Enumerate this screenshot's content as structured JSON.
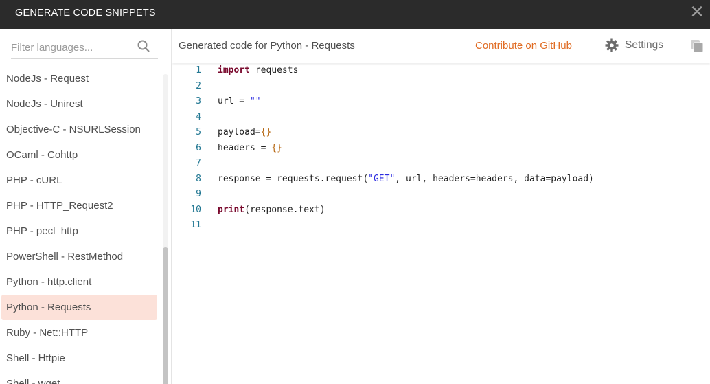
{
  "window": {
    "title": "GENERATE CODE SNIPPETS",
    "close_icon": "close-icon"
  },
  "sidebar": {
    "filter_placeholder": "Filter languages...",
    "items": [
      {
        "label": "NodeJs - Request"
      },
      {
        "label": "NodeJs - Unirest"
      },
      {
        "label": "Objective-C - NSURLSession"
      },
      {
        "label": "OCaml - Cohttp"
      },
      {
        "label": "PHP - cURL"
      },
      {
        "label": "PHP - HTTP_Request2"
      },
      {
        "label": "PHP - pecl_http"
      },
      {
        "label": "PowerShell - RestMethod"
      },
      {
        "label": "Python - http.client"
      },
      {
        "label": "Python - Requests",
        "selected": true
      },
      {
        "label": "Ruby - Net::HTTP"
      },
      {
        "label": "Shell - Httpie"
      },
      {
        "label": "Shell - wget"
      }
    ]
  },
  "header": {
    "title": "Generated code for Python - Requests",
    "github_link": "Contribute on GitHub",
    "settings_label": "Settings"
  },
  "colors": {
    "accent": "#e06c24",
    "selected_bg": "#fce1d9",
    "titlebar": "#2b2b2b"
  },
  "code": {
    "lines": [
      {
        "n": "1",
        "parts": [
          {
            "t": "import",
            "c": "kw"
          },
          {
            "t": " requests"
          }
        ]
      },
      {
        "n": "2",
        "parts": []
      },
      {
        "n": "3",
        "parts": [
          {
            "t": "url = "
          },
          {
            "t": "\"\"",
            "c": "st"
          }
        ]
      },
      {
        "n": "4",
        "parts": []
      },
      {
        "n": "5",
        "parts": [
          {
            "t": "payload="
          },
          {
            "t": "{}",
            "c": "br"
          }
        ]
      },
      {
        "n": "6",
        "parts": [
          {
            "t": "headers = "
          },
          {
            "t": "{}",
            "c": "br"
          }
        ]
      },
      {
        "n": "7",
        "parts": []
      },
      {
        "n": "8",
        "parts": [
          {
            "t": "response = requests.request("
          },
          {
            "t": "\"GET\"",
            "c": "st"
          },
          {
            "t": ", url, headers=headers, data=payload)"
          }
        ]
      },
      {
        "n": "9",
        "parts": []
      },
      {
        "n": "10",
        "parts": [
          {
            "t": "print",
            "c": "kw"
          },
          {
            "t": "(response.text)"
          }
        ]
      },
      {
        "n": "11",
        "parts": []
      }
    ]
  }
}
